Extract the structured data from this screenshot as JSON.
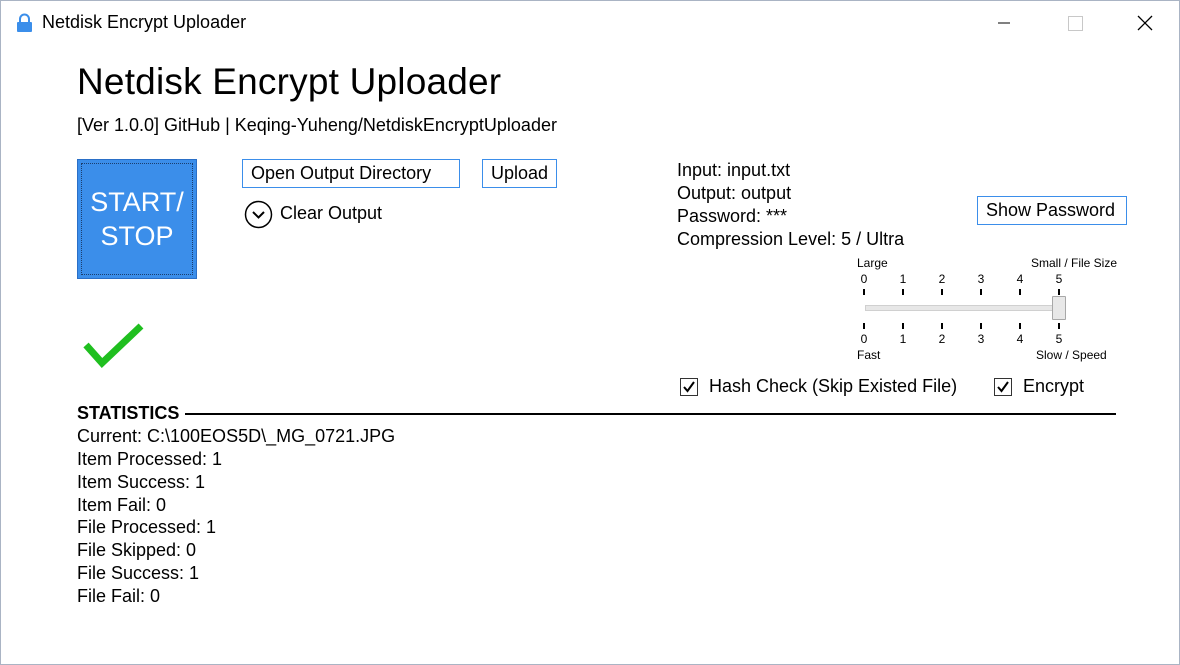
{
  "window": {
    "title": "Netdisk Encrypt Uploader",
    "icon": "lock-icon",
    "controls": [
      "minimize-icon",
      "maximize-icon",
      "close-icon"
    ]
  },
  "header": {
    "title": "Netdisk Encrypt Uploader",
    "subtitle": "[Ver 1.0.0] GitHub | Keqing-Yuheng/NetdiskEncryptUploader"
  },
  "actions": {
    "start_stop": "START/\nSTOP",
    "open_output_directory": "Open Output Directory",
    "upload": "Upload",
    "clear_output": "Clear Output",
    "clear_output_icon": "chevron-down-circle-icon",
    "show_password": "Show Password"
  },
  "status": {
    "icon": "checkmark-icon",
    "color": "#1fbf1f"
  },
  "info": {
    "input": "Input: input.txt",
    "output": "Output: output",
    "password": "Password: ***",
    "compression": "Compression Level: 5 / Ultra"
  },
  "compression_slider": {
    "top_left_label": "Large",
    "top_right_label": "Small / File Size",
    "bottom_left_label": "Fast",
    "bottom_right_label": "Slow / Speed",
    "ticks": [
      "0",
      "1",
      "2",
      "3",
      "4",
      "5"
    ],
    "min": 0,
    "max": 5,
    "value": 5
  },
  "options": {
    "hash_check": {
      "label": "Hash Check (Skip Existed File)",
      "checked": true
    },
    "encrypt": {
      "label": "Encrypt",
      "checked": true
    }
  },
  "statistics": {
    "header": "STATISTICS",
    "lines": [
      "Current: C:\\100EOS5D\\_MG_0721.JPG",
      "Item Processed: 1",
      "Item Success: 1",
      "Item Fail: 0",
      "File Processed: 1",
      "File Skipped: 0",
      "File Success: 1",
      "File Fail: 0"
    ]
  },
  "colors": {
    "accent": "#3b8eea",
    "success": "#1fbf1f"
  }
}
